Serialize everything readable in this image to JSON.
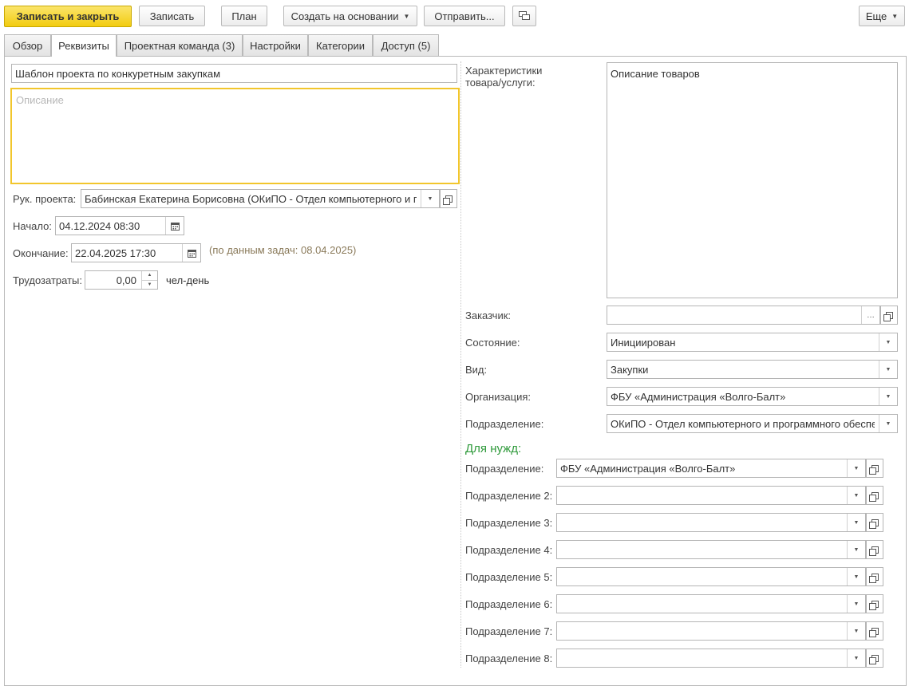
{
  "toolbar": {
    "save_close": "Записать и закрыть",
    "save": "Записать",
    "plan": "План",
    "create_based": "Создать на основании",
    "send": "Отправить...",
    "more": "Еще"
  },
  "tabs": [
    {
      "label": "Обзор"
    },
    {
      "label": "Реквизиты"
    },
    {
      "label": "Проектная команда (3)"
    },
    {
      "label": "Настройки"
    },
    {
      "label": "Категории"
    },
    {
      "label": "Доступ (5)"
    }
  ],
  "left": {
    "name_value": "Шаблон проекта по конкуретным закупкам",
    "description_placeholder": "Описание",
    "manager_label": "Рук. проекта:",
    "manager_value": "Бабинская Екатерина Борисовна (ОКиПО - Отдел компьютерного и программного обеспечения)",
    "start_label": "Начало:",
    "start_value": "04.12.2024 08:30",
    "end_label": "Окончание:",
    "end_value": "22.04.2025 17:30",
    "end_hint": "(по данным задач: 08.04.2025)",
    "labor_label": "Трудозатраты:",
    "labor_value": "0,00",
    "labor_unit": "чел-день"
  },
  "right": {
    "characteristics_label": "Характеристики товара/услуги:",
    "characteristics_value": "Описание товаров",
    "customer_label": "Заказчик:",
    "customer_value": "",
    "state_label": "Состояние:",
    "state_value": "Инициирован",
    "kind_label": "Вид:",
    "kind_value": "Закупки",
    "org_label": "Организация:",
    "org_value": "ФБУ «Администрация «Волго-Балт»",
    "dept_label": "Подразделение:",
    "dept_value": "ОКиПО - Отдел компьютерного и программного обеспечения",
    "needs_title": "Для нужд:",
    "needs": [
      {
        "label": "Подразделение:",
        "value": "ФБУ «Администрация «Волго-Балт»"
      },
      {
        "label": "Подразделение 2:",
        "value": ""
      },
      {
        "label": "Подразделение 3:",
        "value": ""
      },
      {
        "label": "Подразделение 4:",
        "value": ""
      },
      {
        "label": "Подразделение 5:",
        "value": ""
      },
      {
        "label": "Подразделение 6:",
        "value": ""
      },
      {
        "label": "Подразделение 7:",
        "value": ""
      },
      {
        "label": "Подразделение 8:",
        "value": ""
      }
    ]
  },
  "icons": {
    "dropdown": "▼",
    "ellipsis": "...",
    "calendar": "calendar-icon",
    "open": "open-icon",
    "chat": "chat-icon"
  },
  "colors": {
    "primary_button": "#f2cc10",
    "focus_border": "#f2c62c",
    "needs_title": "#2f9a3b"
  }
}
